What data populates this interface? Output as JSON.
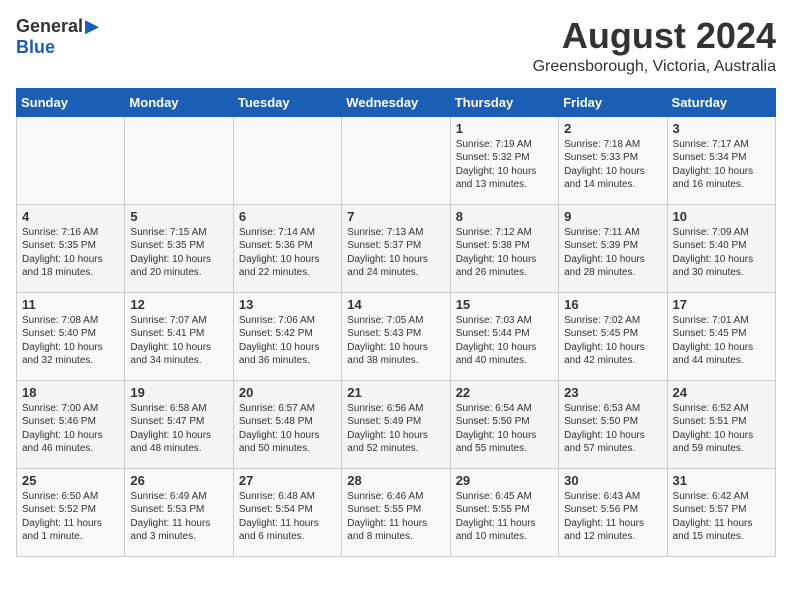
{
  "header": {
    "logo_general": "General",
    "logo_blue": "Blue",
    "month_title": "August 2024",
    "location": "Greensborough, Victoria, Australia"
  },
  "calendar": {
    "days_of_week": [
      "Sunday",
      "Monday",
      "Tuesday",
      "Wednesday",
      "Thursday",
      "Friday",
      "Saturday"
    ],
    "weeks": [
      [
        {
          "day": "",
          "info": ""
        },
        {
          "day": "",
          "info": ""
        },
        {
          "day": "",
          "info": ""
        },
        {
          "day": "",
          "info": ""
        },
        {
          "day": "1",
          "info": "Sunrise: 7:19 AM\nSunset: 5:32 PM\nDaylight: 10 hours\nand 13 minutes."
        },
        {
          "day": "2",
          "info": "Sunrise: 7:18 AM\nSunset: 5:33 PM\nDaylight: 10 hours\nand 14 minutes."
        },
        {
          "day": "3",
          "info": "Sunrise: 7:17 AM\nSunset: 5:34 PM\nDaylight: 10 hours\nand 16 minutes."
        }
      ],
      [
        {
          "day": "4",
          "info": "Sunrise: 7:16 AM\nSunset: 5:35 PM\nDaylight: 10 hours\nand 18 minutes."
        },
        {
          "day": "5",
          "info": "Sunrise: 7:15 AM\nSunset: 5:35 PM\nDaylight: 10 hours\nand 20 minutes."
        },
        {
          "day": "6",
          "info": "Sunrise: 7:14 AM\nSunset: 5:36 PM\nDaylight: 10 hours\nand 22 minutes."
        },
        {
          "day": "7",
          "info": "Sunrise: 7:13 AM\nSunset: 5:37 PM\nDaylight: 10 hours\nand 24 minutes."
        },
        {
          "day": "8",
          "info": "Sunrise: 7:12 AM\nSunset: 5:38 PM\nDaylight: 10 hours\nand 26 minutes."
        },
        {
          "day": "9",
          "info": "Sunrise: 7:11 AM\nSunset: 5:39 PM\nDaylight: 10 hours\nand 28 minutes."
        },
        {
          "day": "10",
          "info": "Sunrise: 7:09 AM\nSunset: 5:40 PM\nDaylight: 10 hours\nand 30 minutes."
        }
      ],
      [
        {
          "day": "11",
          "info": "Sunrise: 7:08 AM\nSunset: 5:40 PM\nDaylight: 10 hours\nand 32 minutes."
        },
        {
          "day": "12",
          "info": "Sunrise: 7:07 AM\nSunset: 5:41 PM\nDaylight: 10 hours\nand 34 minutes."
        },
        {
          "day": "13",
          "info": "Sunrise: 7:06 AM\nSunset: 5:42 PM\nDaylight: 10 hours\nand 36 minutes."
        },
        {
          "day": "14",
          "info": "Sunrise: 7:05 AM\nSunset: 5:43 PM\nDaylight: 10 hours\nand 38 minutes."
        },
        {
          "day": "15",
          "info": "Sunrise: 7:03 AM\nSunset: 5:44 PM\nDaylight: 10 hours\nand 40 minutes."
        },
        {
          "day": "16",
          "info": "Sunrise: 7:02 AM\nSunset: 5:45 PM\nDaylight: 10 hours\nand 42 minutes."
        },
        {
          "day": "17",
          "info": "Sunrise: 7:01 AM\nSunset: 5:45 PM\nDaylight: 10 hours\nand 44 minutes."
        }
      ],
      [
        {
          "day": "18",
          "info": "Sunrise: 7:00 AM\nSunset: 5:46 PM\nDaylight: 10 hours\nand 46 minutes."
        },
        {
          "day": "19",
          "info": "Sunrise: 6:58 AM\nSunset: 5:47 PM\nDaylight: 10 hours\nand 48 minutes."
        },
        {
          "day": "20",
          "info": "Sunrise: 6:57 AM\nSunset: 5:48 PM\nDaylight: 10 hours\nand 50 minutes."
        },
        {
          "day": "21",
          "info": "Sunrise: 6:56 AM\nSunset: 5:49 PM\nDaylight: 10 hours\nand 52 minutes."
        },
        {
          "day": "22",
          "info": "Sunrise: 6:54 AM\nSunset: 5:50 PM\nDaylight: 10 hours\nand 55 minutes."
        },
        {
          "day": "23",
          "info": "Sunrise: 6:53 AM\nSunset: 5:50 PM\nDaylight: 10 hours\nand 57 minutes."
        },
        {
          "day": "24",
          "info": "Sunrise: 6:52 AM\nSunset: 5:51 PM\nDaylight: 10 hours\nand 59 minutes."
        }
      ],
      [
        {
          "day": "25",
          "info": "Sunrise: 6:50 AM\nSunset: 5:52 PM\nDaylight: 11 hours\nand 1 minute."
        },
        {
          "day": "26",
          "info": "Sunrise: 6:49 AM\nSunset: 5:53 PM\nDaylight: 11 hours\nand 3 minutes."
        },
        {
          "day": "27",
          "info": "Sunrise: 6:48 AM\nSunset: 5:54 PM\nDaylight: 11 hours\nand 6 minutes."
        },
        {
          "day": "28",
          "info": "Sunrise: 6:46 AM\nSunset: 5:55 PM\nDaylight: 11 hours\nand 8 minutes."
        },
        {
          "day": "29",
          "info": "Sunrise: 6:45 AM\nSunset: 5:55 PM\nDaylight: 11 hours\nand 10 minutes."
        },
        {
          "day": "30",
          "info": "Sunrise: 6:43 AM\nSunset: 5:56 PM\nDaylight: 11 hours\nand 12 minutes."
        },
        {
          "day": "31",
          "info": "Sunrise: 6:42 AM\nSunset: 5:57 PM\nDaylight: 11 hours\nand 15 minutes."
        }
      ]
    ]
  }
}
